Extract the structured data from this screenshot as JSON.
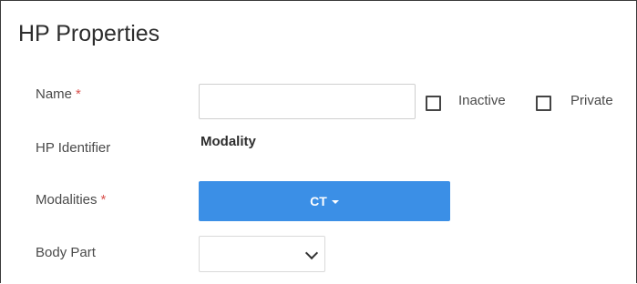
{
  "title": "HP Properties",
  "form": {
    "name_label": "Name",
    "required_mark": "*",
    "name_value": "",
    "inactive_label": "Inactive",
    "inactive_checked": false,
    "private_label": "Private",
    "private_checked": false,
    "hp_identifier_label": "HP Identifier",
    "hp_identifier_value": "Modality",
    "modalities_label": "Modalities",
    "modalities_value": "CT",
    "body_part_label": "Body Part",
    "body_part_value": ""
  },
  "icons": {
    "modalities_dropdown": "caret-down-icon",
    "body_part_dropdown": "chevron-down-icon"
  },
  "colors": {
    "accent": "#3b8fe6",
    "required": "#d9534f"
  }
}
